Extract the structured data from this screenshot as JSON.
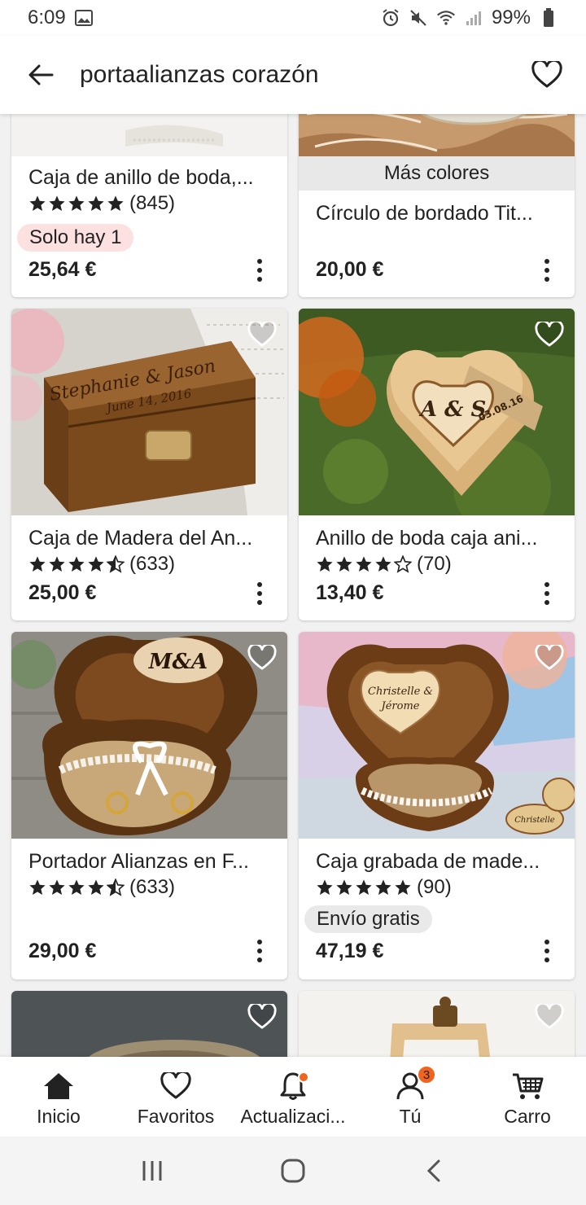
{
  "status_bar": {
    "time": "6:09",
    "battery": "99%"
  },
  "app_bar": {
    "query": "portaalianzas corazón"
  },
  "listings": [
    {
      "title": "Caja de anillo de boda,...",
      "stars": 5,
      "rating_count": "(845)",
      "badge": "Solo hay 1",
      "price": "25,64 €"
    },
    {
      "title": "Círculo de bordado Tit...",
      "more_colors": "Más colores",
      "price": "20,00 €"
    },
    {
      "title": "Caja de Madera del An...",
      "stars": 4.5,
      "rating_count": "(633)",
      "price": "25,00 €"
    },
    {
      "title": "Anillo de boda caja ani...",
      "stars": 4,
      "rating_count": "(70)",
      "price": "13,40 €"
    },
    {
      "title": "Portador Alianzas en F...",
      "stars": 4.5,
      "rating_count": "(633)",
      "price": "29,00 €"
    },
    {
      "title": "Caja grabada de made...",
      "stars": 5,
      "rating_count": "(90)",
      "badge": "Envío gratis",
      "price": "47,19 €"
    }
  ],
  "images": {
    "img3": {
      "line1": "Stephanie & Jason",
      "line2": "June 14, 2016"
    },
    "img4": {
      "initials": "A & S",
      "date": "03.08.16"
    },
    "img5": {
      "initials": "M&A"
    },
    "img6": {
      "line1": "Christelle &",
      "line2": "Jérome",
      "tag": "Christelle"
    }
  },
  "bottom_nav": [
    {
      "label": "Inicio",
      "icon": "home-icon"
    },
    {
      "label": "Favoritos",
      "icon": "heart-icon"
    },
    {
      "label": "Actualizaci...",
      "icon": "bell-icon"
    },
    {
      "label": "Tú",
      "icon": "person-icon",
      "badge": "3"
    },
    {
      "label": "Carro",
      "icon": "cart-icon"
    }
  ],
  "colors": {
    "accent": "#f1641e",
    "badge_red": "#fde0e0",
    "badge_gray": "#e9e9e9"
  }
}
